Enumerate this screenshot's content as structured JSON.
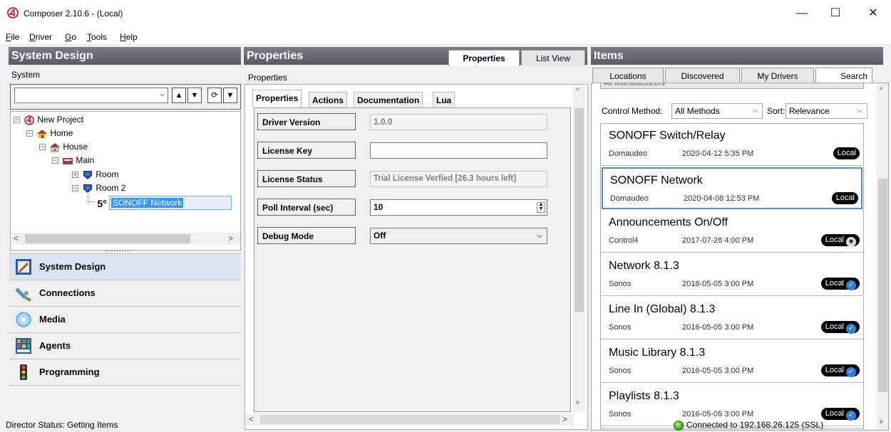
{
  "window": {
    "title": "Composer 2.10.6 - (Local)",
    "min": "—",
    "max": "☐",
    "close": "✕"
  },
  "menu": [
    "File",
    "Driver",
    "Go",
    "Tools",
    "Help"
  ],
  "system_design": {
    "header": "System Design",
    "system_label": "System",
    "tree": [
      {
        "label": "New Project"
      },
      {
        "label": "Home"
      },
      {
        "label": "House"
      },
      {
        "label": "Main"
      },
      {
        "label": "Room"
      },
      {
        "label": "Room 2"
      },
      {
        "label": "SONOFF Network"
      }
    ],
    "splitter": "..........",
    "nav": [
      "System Design",
      "Connections",
      "Media",
      "Agents",
      "Programming"
    ]
  },
  "properties": {
    "header": "Properties",
    "top_tabs": [
      "Properties",
      "List View"
    ],
    "sub_label": "Properties",
    "tabs": [
      "Properties",
      "Actions",
      "Documentation",
      "Lua"
    ],
    "fields": [
      {
        "label": "Driver Version",
        "value": "1.0.0"
      },
      {
        "label": "License Key",
        "value": ""
      },
      {
        "label": "License Status",
        "value": "Trial License Verfied [26.3 hours left]"
      },
      {
        "label": "Poll Interval (sec)",
        "value": "10"
      },
      {
        "label": "Debug Mode",
        "value": "Off"
      }
    ]
  },
  "items": {
    "header": "Items",
    "tabs": [
      "Locations",
      "Discovered",
      "My Drivers",
      "Search"
    ],
    "manufacturer_stub": "All Manufacturers",
    "control_method_label": "Control Method:",
    "control_method_value": "All Methods",
    "sort_label": "Sort:",
    "sort_value": "Relevance",
    "list": [
      {
        "name": "SONOFF Switch/Relay",
        "vendor": "Domaudeo",
        "date": "2020-04-12 5:35 PM",
        "badge": "Local",
        "extra": ""
      },
      {
        "name": "SONOFF Network",
        "vendor": "Domaudeo",
        "date": "2020-04-08 12:53 PM",
        "badge": "Local",
        "extra": ""
      },
      {
        "name": "Announcements On/Off",
        "vendor": "Control4",
        "date": "2017-07-28 4:00 PM",
        "badge": "Local",
        "extra": "lock"
      },
      {
        "name": "Network 8.1.3",
        "vendor": "Sonos",
        "date": "2016-05-05 3:00 PM",
        "badge": "Local",
        "extra": "check"
      },
      {
        "name": "Line In (Global) 8.1.3",
        "vendor": "Sonos",
        "date": "2016-05-05 3:00 PM",
        "badge": "Local",
        "extra": "check"
      },
      {
        "name": "Music Library 8.1.3",
        "vendor": "Sonos",
        "date": "2016-05-05 3:00 PM",
        "badge": "Local",
        "extra": "check"
      },
      {
        "name": "Playlists 8.1.3",
        "vendor": "Sonos",
        "date": "2016-05-05 3:00 PM",
        "badge": "Local",
        "extra": "check"
      }
    ]
  },
  "status": {
    "left": "Director Status: Getting Items",
    "right": "Connected to 192.168.26.125 (SSL)"
  },
  "colors": {
    "accent": "#3399ff",
    "header_bg": "#5f626c",
    "connected": "#3fae1c"
  }
}
